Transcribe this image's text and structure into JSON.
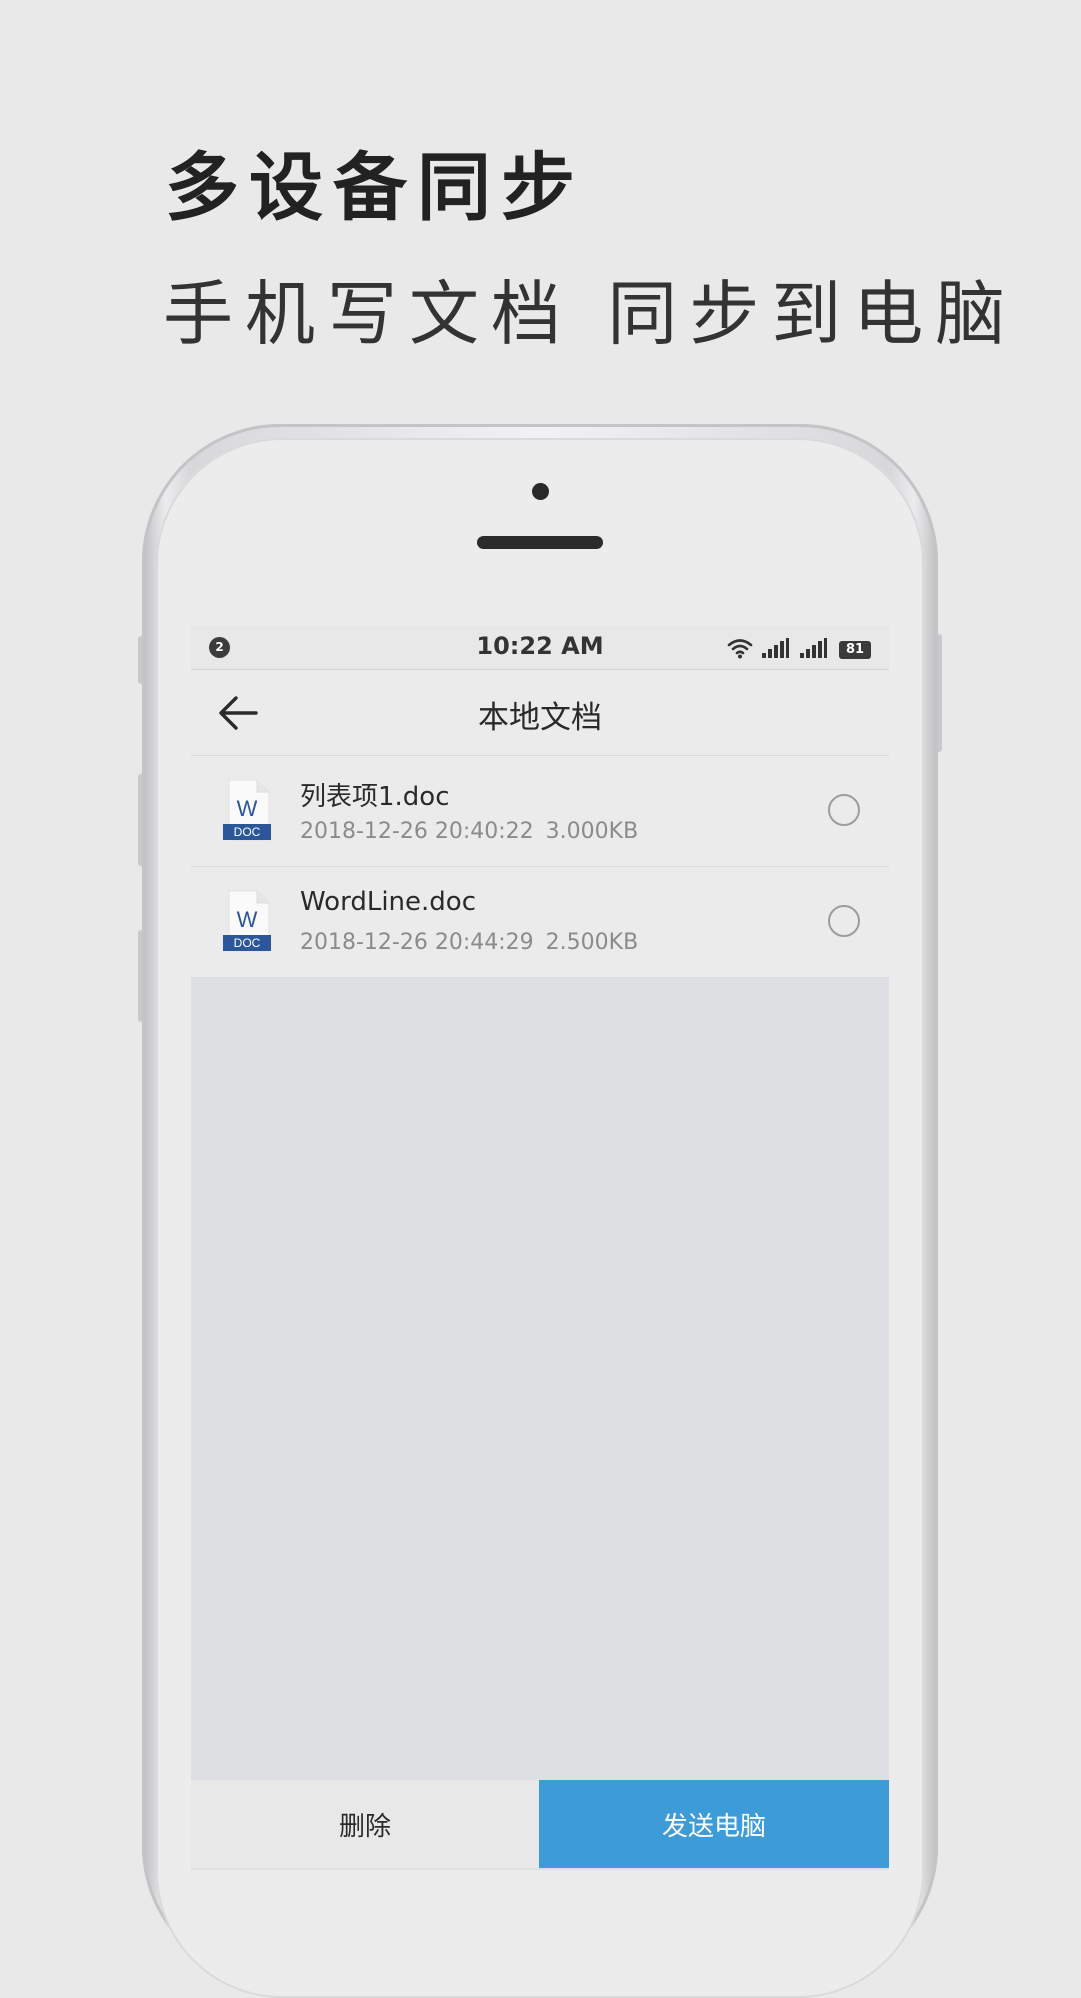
{
  "promo": {
    "headline": "多设备同步",
    "subheadline": "手机写文档 同步到电脑"
  },
  "status_bar": {
    "notification_count": "2",
    "time": "10:22 AM",
    "battery": "81",
    "icons": [
      "wifi-icon",
      "signal-icon",
      "signal-2-icon",
      "battery-icon"
    ]
  },
  "nav": {
    "title": "本地文档",
    "back_icon": "arrow-left-icon"
  },
  "files": [
    {
      "icon": "word-doc-icon",
      "icon_letter": "W",
      "icon_label": "DOC",
      "name": "列表项1.doc",
      "datetime": "2018-12-26 20:40:22",
      "size": "3.000KB",
      "selected": false
    },
    {
      "icon": "word-doc-icon",
      "icon_letter": "W",
      "icon_label": "DOC",
      "name": "WordLine.doc",
      "datetime": "2018-12-26 20:44:29",
      "size": "2.500KB",
      "selected": false
    }
  ],
  "actions": {
    "delete_label": "删除",
    "send_label": "发送电脑"
  },
  "colors": {
    "accent": "#3d9bd8",
    "doc_icon_blue": "#2b579a",
    "background": "#e9e9ea"
  }
}
